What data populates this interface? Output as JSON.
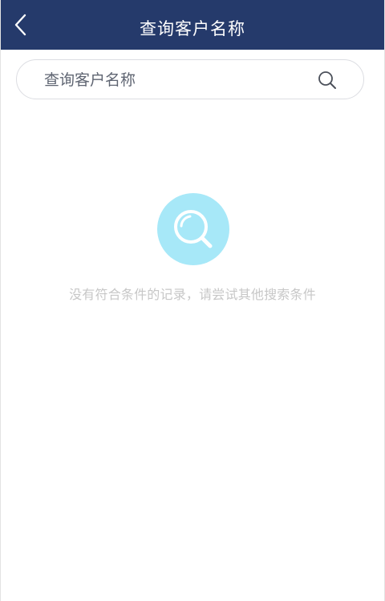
{
  "header": {
    "title": "查询客户名称",
    "back_icon": "chevron-left-icon"
  },
  "search": {
    "placeholder": "查询客户名称",
    "value": "",
    "icon": "search-icon"
  },
  "empty_state": {
    "icon": "magnifier-icon",
    "message": "没有符合条件的记录，请尝试其他搜索条件"
  },
  "colors": {
    "header_background": "#253a6b",
    "header_text": "#ffffff",
    "empty_icon_background": "#a7e8f8",
    "empty_message_text": "#c7c7c7"
  }
}
